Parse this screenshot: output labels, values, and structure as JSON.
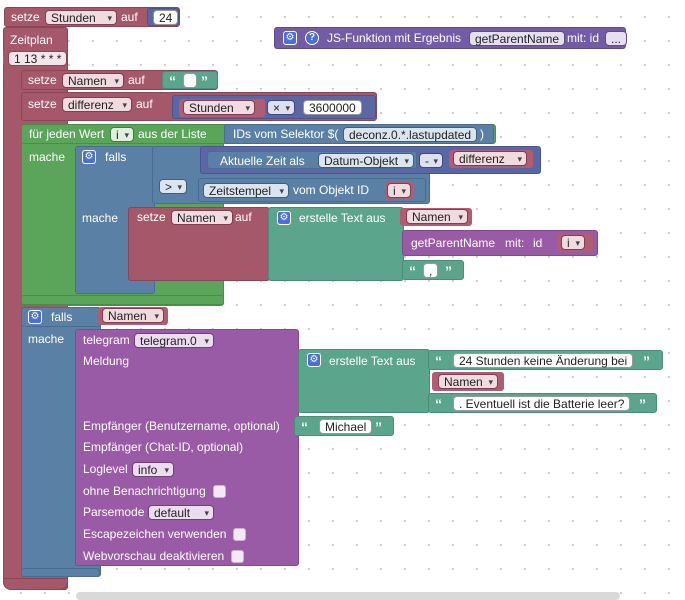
{
  "blocks": {
    "set_hours": {
      "setze": "setze",
      "var": "Stunden",
      "auf": "auf",
      "value": "24"
    },
    "schedule": {
      "label": "Zeitplan",
      "cron": "1 13 * * *"
    },
    "set_names": {
      "setze": "setze",
      "var": "Namen",
      "auf": "auf",
      "value": ""
    },
    "set_diff": {
      "setze": "setze",
      "var": "differenz",
      "auf": "auf",
      "mul_var": "Stunden",
      "op": "×",
      "num": "3600000"
    },
    "foreach": {
      "label": "für jeden Wert",
      "var": "i",
      "mid": "aus der Liste",
      "selector_label": "IDs vom Selektor $(",
      "selector": "deconz.0.*.lastupdated",
      "close": ")",
      "mache": "mache"
    },
    "if1": {
      "falls": "falls",
      "mache": "mache",
      "now_label": "Aktuelle Zeit als",
      "now_format": "Datum-Objekt",
      "minus": "-",
      "diff_var": "differenz",
      "cmp": ">",
      "ts_sel": "Zeitstempel",
      "ts_label": "vom Objekt ID",
      "ts_var": "i"
    },
    "set_names2": {
      "setze": "setze",
      "var": "Namen",
      "auf": "auf",
      "create_text": "erstelle Text aus",
      "names_var": "Namen",
      "parent_label": "getParentName",
      "parent_mit": "mit:",
      "parent_id": "id",
      "parent_var": "i",
      "sep": ","
    },
    "jsfunc": {
      "label": "JS-Funktion mit Ergebnis",
      "name": "getParentName",
      "mit": "mit: id",
      "more": "..."
    },
    "if2": {
      "falls": "falls",
      "var": "Namen",
      "mache": "mache"
    },
    "telegram": {
      "label": "telegram",
      "instance": "telegram.0",
      "meldung": "Meldung",
      "create_text": "erstelle Text aus",
      "text1": "24 Stunden keine Änderung bei",
      "text_var": "Namen",
      "text2": ". Eventuell ist die Batterie leer?",
      "recipient_user": "Empfänger (Benutzername, optional)",
      "recipient_value": "Michael",
      "recipient_chat": "Empfänger (Chat-ID, optional)",
      "loglevel": "Loglevel",
      "loglevel_value": "info",
      "silent": "ohne Benachrichtigung",
      "parsemode": "Parsemode",
      "parsemode_value": "default",
      "escape": "Escapezeichen verwenden",
      "webpreview": "Webvorschau deaktivieren"
    }
  },
  "colors": {
    "event": "#a5586a",
    "logic": "#5b80a5",
    "loop": "#5ba55b",
    "text": "#5ba58c",
    "variable": "#a55b80",
    "function": "#995ba5",
    "math": "#5b67a5"
  }
}
